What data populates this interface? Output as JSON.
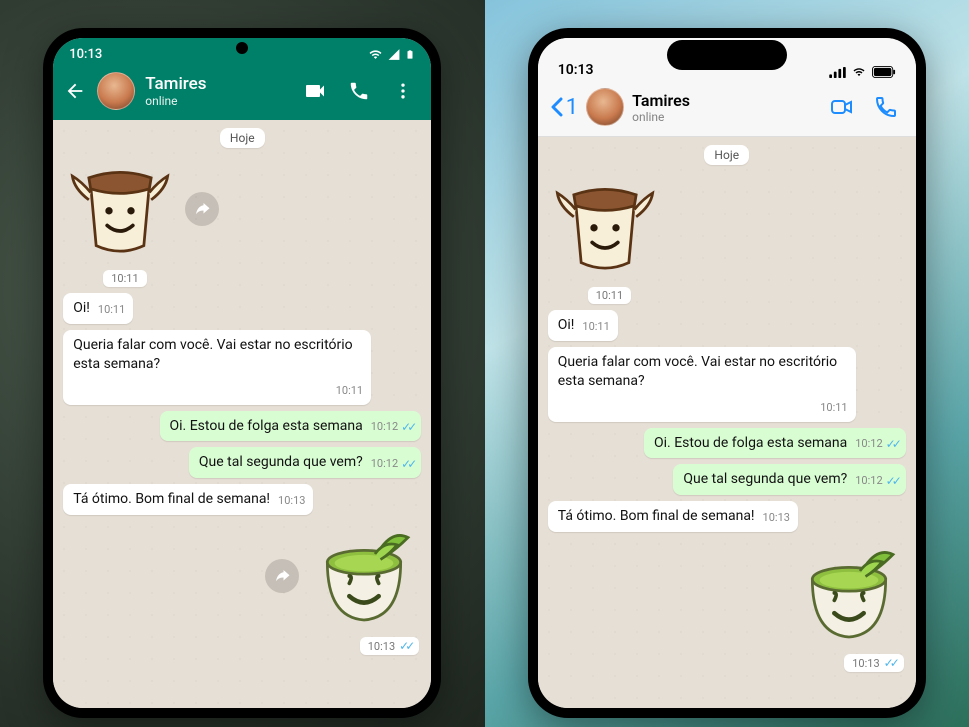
{
  "status_time": "10:13",
  "contact": {
    "name": "Tamires",
    "status": "online"
  },
  "date_label": "Hoje",
  "ios_back_count": "1",
  "messages": {
    "sticker_in_time": "10:11",
    "m1": "Oi!",
    "m1_time": "10:11",
    "m2": "Queria falar com você. Vai estar no escritório esta semana?",
    "m2_time": "10:11",
    "m3": "Oi. Estou de folga esta semana",
    "m3_time": "10:12",
    "m4": "Que tal segunda que vem?",
    "m4_time": "10:12",
    "m5": "Tá ótimo. Bom final de semana!",
    "m5_time": "10:13",
    "sticker_out_time": "10:13"
  }
}
